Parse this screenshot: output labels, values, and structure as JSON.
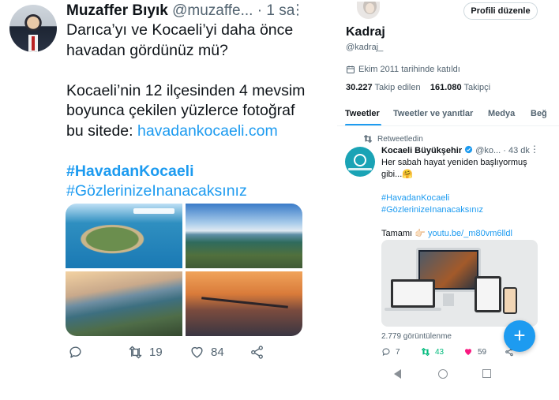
{
  "left_tweet": {
    "author_name": "Muzaffer Bıyık",
    "handle": "@muzaffe...",
    "separator": "·",
    "time": "1 sa",
    "lines1": [
      "Darıca’yı ve Kocaeli’yi daha önce",
      "havadan gördünüz mü?"
    ],
    "lines2": [
      "Kocaeli’nin 12 ilçesinden 4 mevsim",
      "boyunca çekilen yüzlerce fotoğraf"
    ],
    "line3_prefix": "bu sitede: ",
    "link": "havadankocaeli.com",
    "hashtag1": "#HavadanKocaeli",
    "hashtag2": "#GözlerinizeInanacaksınız",
    "reply_count": "",
    "retweet_count": "19",
    "like_count": "84"
  },
  "profile": {
    "edit_button": "Profili düzenle",
    "name": "Kadraj",
    "handle": "@kadraj_",
    "joined": "Ekim 2011 tarihinde katıldı",
    "following_count": "30.227",
    "following_label": "Takip edilen",
    "followers_count": "161.080",
    "followers_label": "Takipçi",
    "tabs": [
      "Tweetler",
      "Tweetler ve yanıtlar",
      "Medya",
      "Beğ"
    ]
  },
  "retweet": {
    "label": "Retweetledin",
    "author_name": "Kocaeli Büyükşehir",
    "meta": "@ko... · 43 dk",
    "text1": "Her sabah hayat yeniden başlıyormuş",
    "text2": "gibi...🤗",
    "hashtag1": "#HavadanKocaeli",
    "hashtag2": "#GözlerinizeInanacaksınız",
    "watch_prefix": "Tamamı 👉🏻 ",
    "watch_link": "youtu.be/_m80vm6lldl",
    "views": "2.779 görüntülenme",
    "reply_count": "7",
    "retweet_count": "43",
    "like_count": "59"
  },
  "fab_label": "+",
  "colors": {
    "accent": "#1d9bf0",
    "retweet_green": "#00ba7c",
    "like_pink": "#f91880",
    "muted": "#536471"
  }
}
